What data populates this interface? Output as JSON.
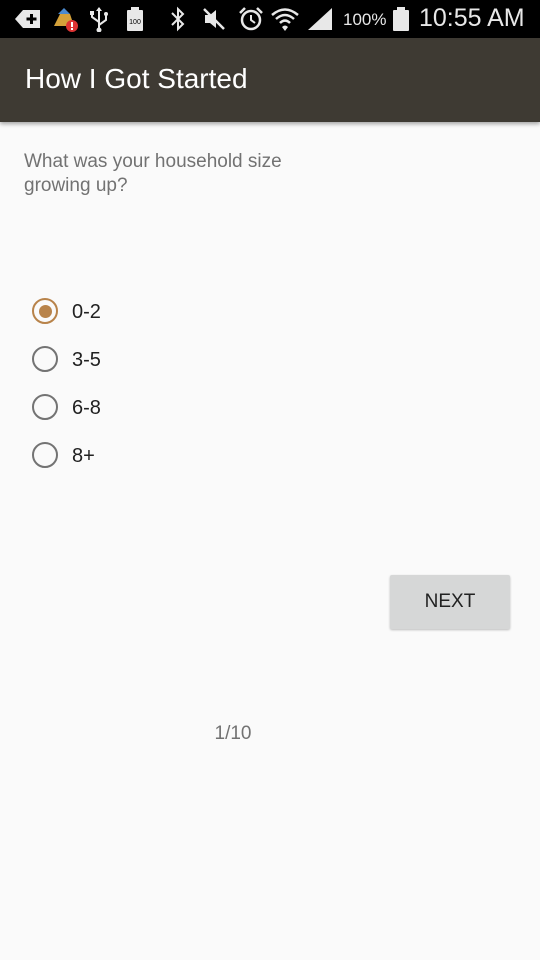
{
  "status_bar": {
    "icons": [
      "add-icon",
      "cleaner-alert-icon",
      "usb-icon",
      "battery-100-icon",
      "bluetooth-icon",
      "mute-icon",
      "alarm-icon",
      "wifi-icon",
      "signal-icon",
      "battery-icon"
    ],
    "battery_percent": "100%",
    "time": "10:55 AM"
  },
  "app_bar": {
    "title": "How I Got Started",
    "color": "#3e3a33"
  },
  "question": {
    "text": "What was your household size growing up?"
  },
  "options": [
    {
      "label": "0-2",
      "selected": true
    },
    {
      "label": "3-5",
      "selected": false
    },
    {
      "label": "6-8",
      "selected": false
    },
    {
      "label": "8+",
      "selected": false
    }
  ],
  "accent_color": "#b8834a",
  "next_button": {
    "label": "NEXT"
  },
  "progress": {
    "text": "1/10"
  }
}
